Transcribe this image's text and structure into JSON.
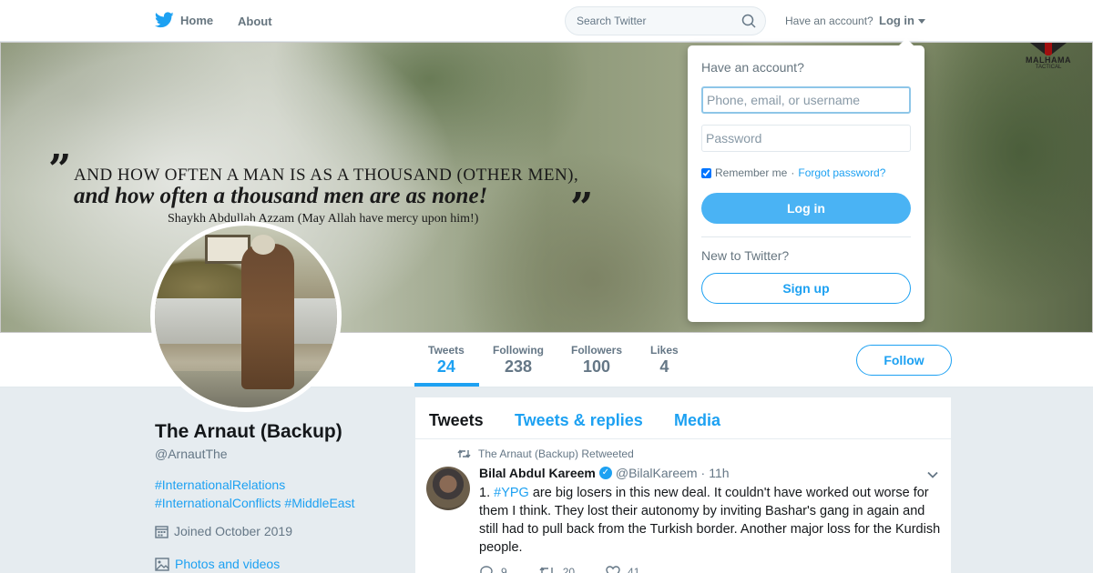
{
  "colors": {
    "accent": "#1da1f2",
    "text_muted": "#657786",
    "page_bg": "#e6ecf0"
  },
  "nav": {
    "home_label": "Home",
    "about_label": "About",
    "search_placeholder": "Search Twitter",
    "have_account": "Have an account?",
    "login_label": "Log in",
    "icons": [
      "twitter-bird-icon",
      "search-icon",
      "caret-down-icon"
    ]
  },
  "banner": {
    "quote_line1": "AND HOW OFTEN A MAN IS AS A THOUSAND (OTHER MEN),",
    "quote_line2": "and how often a thousand men are as none!",
    "quote_attribution": "Shaykh Abdullah Azzam (May Allah have mercy upon him!)",
    "logo_text": "MALHAMA",
    "logo_subtext": "TACTICAL"
  },
  "stats": [
    {
      "label": "Tweets",
      "value": "24",
      "active": true
    },
    {
      "label": "Following",
      "value": "238",
      "active": false
    },
    {
      "label": "Followers",
      "value": "100",
      "active": false
    },
    {
      "label": "Likes",
      "value": "4",
      "active": false
    }
  ],
  "follow_label": "Follow",
  "profile": {
    "name": "The Arnaut (Backup)",
    "handle": "@ArnautThe",
    "bio_line1": "#InternationalRelations",
    "bio_line2": "#InternationalConflicts #MiddleEast",
    "joined": "Joined October 2019",
    "photos_link": "Photos and videos"
  },
  "timeline": {
    "tabs": [
      {
        "label": "Tweets",
        "active": true
      },
      {
        "label": "Tweets & replies",
        "active": false
      },
      {
        "label": "Media",
        "active": false
      }
    ],
    "tweet": {
      "retweet_text": "The Arnaut (Backup) Retweeted",
      "author_name": "Bilal Abdul Kareem",
      "verified_mark": "✓",
      "author_handle": "@BilalKareem",
      "separator": "·",
      "time": "11h",
      "text_prefix": "1. ",
      "hashtag": "#YPG",
      "text_rest": " are big losers in this new deal.  It couldn't have worked out worse for them I think.  They lost their autonomy by inviting Bashar's gang in again and still had to pull back from the Turkish border.  Another major loss for the Kurdish people.",
      "replies": "9",
      "retweets": "20",
      "likes": "41"
    }
  },
  "login_dropdown": {
    "title": "Have an account?",
    "username_placeholder": "Phone, email, or username",
    "password_placeholder": "Password",
    "remember_label": "Remember me",
    "dot": " · ",
    "forgot_label": "Forgot password?",
    "login_button": "Log in",
    "new_label": "New to Twitter?",
    "signup_button": "Sign up"
  }
}
